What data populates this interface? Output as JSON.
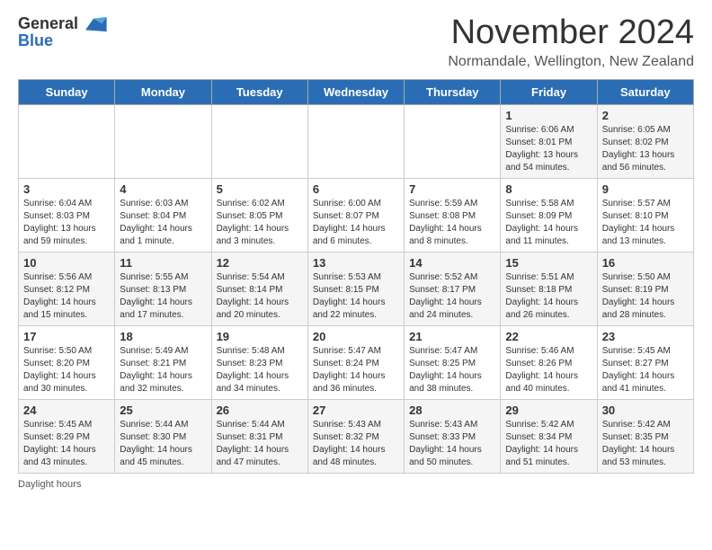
{
  "logo": {
    "general": "General",
    "blue": "Blue"
  },
  "header": {
    "month": "November 2024",
    "location": "Normandale, Wellington, New Zealand"
  },
  "days_of_week": [
    "Sunday",
    "Monday",
    "Tuesday",
    "Wednesday",
    "Thursday",
    "Friday",
    "Saturday"
  ],
  "weeks": [
    [
      {
        "day": "",
        "info": ""
      },
      {
        "day": "",
        "info": ""
      },
      {
        "day": "",
        "info": ""
      },
      {
        "day": "",
        "info": ""
      },
      {
        "day": "",
        "info": ""
      },
      {
        "day": "1",
        "info": "Sunrise: 6:06 AM\nSunset: 8:01 PM\nDaylight: 13 hours and 54 minutes."
      },
      {
        "day": "2",
        "info": "Sunrise: 6:05 AM\nSunset: 8:02 PM\nDaylight: 13 hours and 56 minutes."
      }
    ],
    [
      {
        "day": "3",
        "info": "Sunrise: 6:04 AM\nSunset: 8:03 PM\nDaylight: 13 hours and 59 minutes."
      },
      {
        "day": "4",
        "info": "Sunrise: 6:03 AM\nSunset: 8:04 PM\nDaylight: 14 hours and 1 minute."
      },
      {
        "day": "5",
        "info": "Sunrise: 6:02 AM\nSunset: 8:05 PM\nDaylight: 14 hours and 3 minutes."
      },
      {
        "day": "6",
        "info": "Sunrise: 6:00 AM\nSunset: 8:07 PM\nDaylight: 14 hours and 6 minutes."
      },
      {
        "day": "7",
        "info": "Sunrise: 5:59 AM\nSunset: 8:08 PM\nDaylight: 14 hours and 8 minutes."
      },
      {
        "day": "8",
        "info": "Sunrise: 5:58 AM\nSunset: 8:09 PM\nDaylight: 14 hours and 11 minutes."
      },
      {
        "day": "9",
        "info": "Sunrise: 5:57 AM\nSunset: 8:10 PM\nDaylight: 14 hours and 13 minutes."
      }
    ],
    [
      {
        "day": "10",
        "info": "Sunrise: 5:56 AM\nSunset: 8:12 PM\nDaylight: 14 hours and 15 minutes."
      },
      {
        "day": "11",
        "info": "Sunrise: 5:55 AM\nSunset: 8:13 PM\nDaylight: 14 hours and 17 minutes."
      },
      {
        "day": "12",
        "info": "Sunrise: 5:54 AM\nSunset: 8:14 PM\nDaylight: 14 hours and 20 minutes."
      },
      {
        "day": "13",
        "info": "Sunrise: 5:53 AM\nSunset: 8:15 PM\nDaylight: 14 hours and 22 minutes."
      },
      {
        "day": "14",
        "info": "Sunrise: 5:52 AM\nSunset: 8:17 PM\nDaylight: 14 hours and 24 minutes."
      },
      {
        "day": "15",
        "info": "Sunrise: 5:51 AM\nSunset: 8:18 PM\nDaylight: 14 hours and 26 minutes."
      },
      {
        "day": "16",
        "info": "Sunrise: 5:50 AM\nSunset: 8:19 PM\nDaylight: 14 hours and 28 minutes."
      }
    ],
    [
      {
        "day": "17",
        "info": "Sunrise: 5:50 AM\nSunset: 8:20 PM\nDaylight: 14 hours and 30 minutes."
      },
      {
        "day": "18",
        "info": "Sunrise: 5:49 AM\nSunset: 8:21 PM\nDaylight: 14 hours and 32 minutes."
      },
      {
        "day": "19",
        "info": "Sunrise: 5:48 AM\nSunset: 8:23 PM\nDaylight: 14 hours and 34 minutes."
      },
      {
        "day": "20",
        "info": "Sunrise: 5:47 AM\nSunset: 8:24 PM\nDaylight: 14 hours and 36 minutes."
      },
      {
        "day": "21",
        "info": "Sunrise: 5:47 AM\nSunset: 8:25 PM\nDaylight: 14 hours and 38 minutes."
      },
      {
        "day": "22",
        "info": "Sunrise: 5:46 AM\nSunset: 8:26 PM\nDaylight: 14 hours and 40 minutes."
      },
      {
        "day": "23",
        "info": "Sunrise: 5:45 AM\nSunset: 8:27 PM\nDaylight: 14 hours and 41 minutes."
      }
    ],
    [
      {
        "day": "24",
        "info": "Sunrise: 5:45 AM\nSunset: 8:29 PM\nDaylight: 14 hours and 43 minutes."
      },
      {
        "day": "25",
        "info": "Sunrise: 5:44 AM\nSunset: 8:30 PM\nDaylight: 14 hours and 45 minutes."
      },
      {
        "day": "26",
        "info": "Sunrise: 5:44 AM\nSunset: 8:31 PM\nDaylight: 14 hours and 47 minutes."
      },
      {
        "day": "27",
        "info": "Sunrise: 5:43 AM\nSunset: 8:32 PM\nDaylight: 14 hours and 48 minutes."
      },
      {
        "day": "28",
        "info": "Sunrise: 5:43 AM\nSunset: 8:33 PM\nDaylight: 14 hours and 50 minutes."
      },
      {
        "day": "29",
        "info": "Sunrise: 5:42 AM\nSunset: 8:34 PM\nDaylight: 14 hours and 51 minutes."
      },
      {
        "day": "30",
        "info": "Sunrise: 5:42 AM\nSunset: 8:35 PM\nDaylight: 14 hours and 53 minutes."
      }
    ]
  ],
  "footer": {
    "daylight_label": "Daylight hours"
  }
}
